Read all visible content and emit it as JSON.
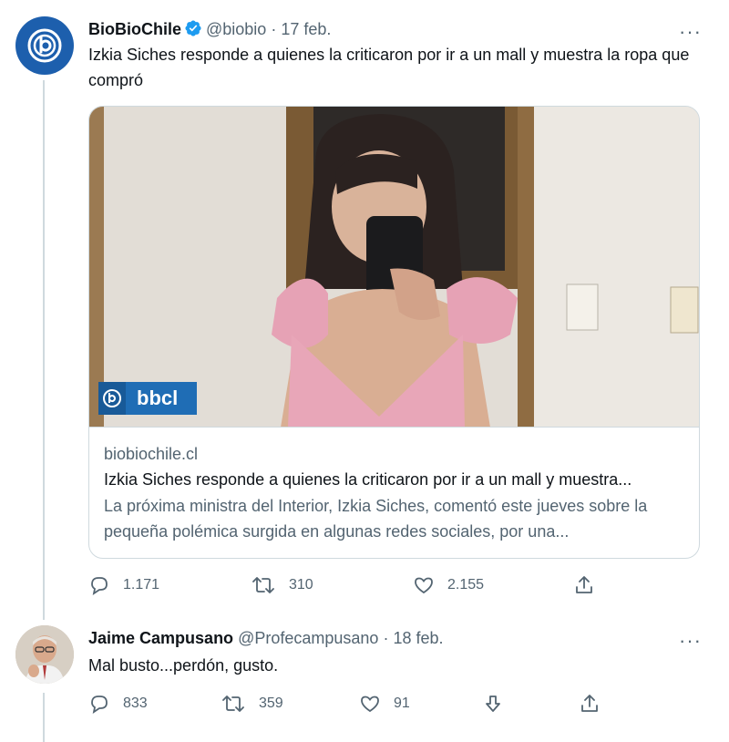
{
  "tweet1": {
    "display_name": "BioBioChile",
    "handle": "@biobio",
    "separator": "·",
    "date": "17 feb.",
    "more": "···",
    "text": "Izkia Siches responde a quienes la criticaron por ir a un mall y muestra la ropa que compró",
    "card": {
      "watermark": "bbcl",
      "domain": "biobiochile.cl",
      "title": "Izkia Siches responde a quienes la criticaron por ir a un mall y muestra...",
      "description": "La próxima ministra del Interior, Izkia Siches, comentó este jueves sobre la pequeña polémica surgida en algunas redes sociales, por una..."
    },
    "actions": {
      "replies": "1.171",
      "retweets": "310",
      "likes": "2.155"
    }
  },
  "tweet2": {
    "display_name": "Jaime Campusano",
    "handle": "@Profecampusano",
    "separator": "·",
    "date": "18 feb.",
    "more": "···",
    "text": "Mal busto...perdón, gusto.",
    "actions": {
      "replies": "833",
      "retweets": "359",
      "likes": "91"
    }
  },
  "colors": {
    "verified_blue": "#1d9bf0",
    "brand_blue": "#1d5fad",
    "secondary_text": "#536471",
    "border": "#cfd9de"
  },
  "icons": [
    "verified-badge-icon",
    "reply-icon",
    "retweet-icon",
    "like-icon",
    "share-icon",
    "downvote-icon",
    "more-icon"
  ]
}
